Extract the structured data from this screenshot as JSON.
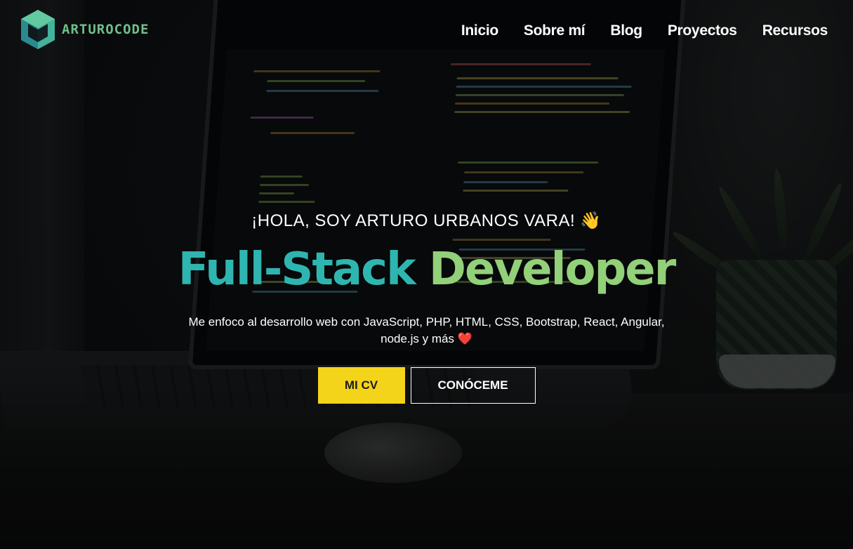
{
  "brand": {
    "name": "ARTUROCODE",
    "logo_icon": "cube-logo-icon"
  },
  "nav": {
    "items": [
      {
        "label": "Inicio"
      },
      {
        "label": "Sobre mí"
      },
      {
        "label": "Blog"
      },
      {
        "label": "Proyectos"
      },
      {
        "label": "Recursos"
      }
    ]
  },
  "hero": {
    "greeting": "¡HOLA, SOY ARTURO URBANOS VARA! 👋",
    "title_part1": "Full-Stack",
    "title_part2": "Developer",
    "subtitle": "Me enfoco al desarrollo web con JavaScript, PHP, HTML, CSS, Bootstrap, React, Angular, node.js y más ❤️",
    "primary_button": "MI CV",
    "secondary_button": "CONÓCEME"
  },
  "colors": {
    "accent_teal": "#2fb5b0",
    "accent_green": "#93d07a",
    "button_yellow": "#f4d31b",
    "logo_green": "#6fbf8a"
  }
}
